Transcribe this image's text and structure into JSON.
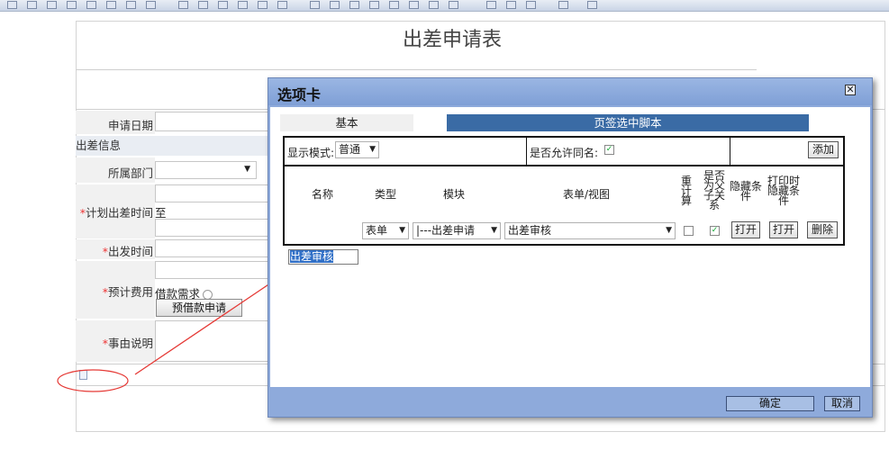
{
  "form": {
    "title": "出差申请表",
    "apply_date_label": "申请日期",
    "section_travel": "出差信息",
    "dept_label": "所属部门",
    "plan_time_label": "计划出差时间",
    "plan_time_to": "至",
    "depart_label": "出发时间",
    "cost_label": "预计费用",
    "loan_label": "借款需求",
    "loan_button": "预借款申请",
    "reason_label": "事由说明"
  },
  "dialog": {
    "title": "选项卡",
    "close": "✕",
    "tabs": [
      {
        "label": "基本"
      },
      {
        "label": "页签选中脚本"
      }
    ],
    "display_mode_label": "显示模式:",
    "display_mode_value": "普通",
    "allow_same_name_label": "是否允许同名:",
    "add_button": "添加",
    "columns": {
      "name": "名称",
      "type": "类型",
      "module": "模块",
      "form_view": "表单/视图",
      "recalc": "重计算",
      "parent_child": "是否为父子关系",
      "hide_cond": "隐藏条件",
      "print_hide_cond": "打印时隐藏条件"
    },
    "row": {
      "name": "出差审核",
      "type": "表单",
      "module": "|---出差申请",
      "form_view": "出差审核",
      "open1": "打开",
      "open2": "打开",
      "delete": "删除",
      "recalc_checked": false,
      "parent_child_checked": true
    },
    "ok_button": "确定",
    "cancel_button": "取消"
  },
  "colors": {
    "dialog_bg": "#8eaadb",
    "tab_active": "#3a6ba5",
    "annotation": "#e53935",
    "required_star": "#e33333"
  }
}
